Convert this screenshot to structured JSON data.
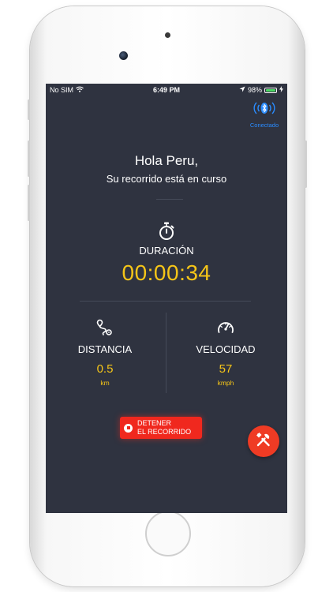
{
  "status_bar": {
    "carrier": "No SIM",
    "time": "6:49 PM",
    "battery_text": "98%",
    "battery_level": 0.98
  },
  "bluetooth": {
    "icon": "bluetooth-icon",
    "label": "Conectado",
    "color": "#2a8cff"
  },
  "header": {
    "greeting": "Hola Peru,",
    "subtitle": "Su recorrido está en curso"
  },
  "duration": {
    "icon": "stopwatch-icon",
    "label": "DURACIÓN",
    "value": "00:00:34"
  },
  "distance": {
    "icon": "route-icon",
    "label": "DISTANCIA",
    "value": "0.5",
    "unit": "km"
  },
  "speed": {
    "icon": "speedometer-icon",
    "label": "VELOCIDAD",
    "value": "57",
    "unit": "kmph"
  },
  "stop_button": {
    "line1": "DETENER",
    "line2": "EL RECORRIDO",
    "color": "#f0281e"
  },
  "fab": {
    "icon": "tools-icon",
    "color": "#ef3b24"
  },
  "colors": {
    "background": "#2f3340",
    "accent": "#f5c518"
  }
}
